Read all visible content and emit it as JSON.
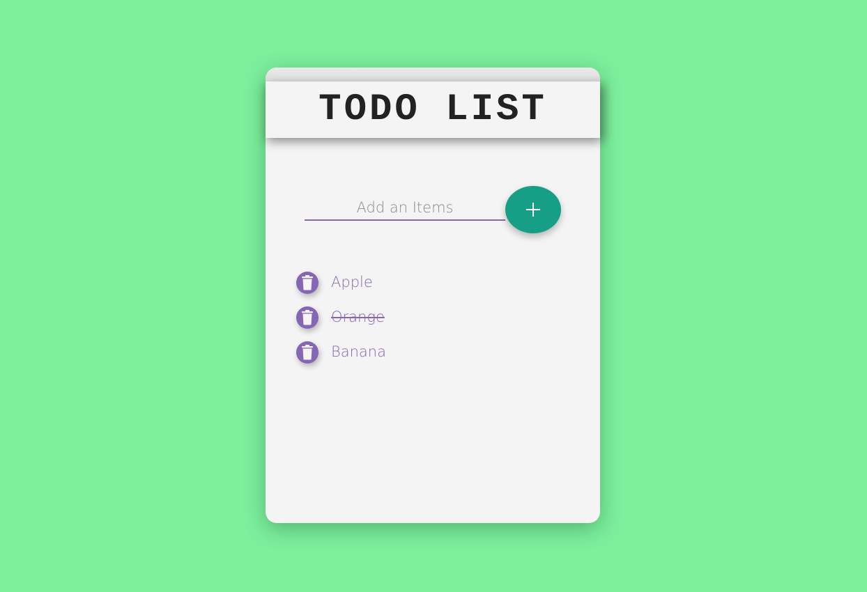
{
  "app": {
    "title": "TODO LIST"
  },
  "input": {
    "placeholder": "Add an Items",
    "value": ""
  },
  "add_button": {
    "icon": "plus-icon"
  },
  "items": [
    {
      "label": "Apple",
      "done": false,
      "icon": "trash-icon"
    },
    {
      "label": "Orange",
      "done": true,
      "icon": "trash-icon"
    },
    {
      "label": "Banana",
      "done": false,
      "icon": "trash-icon"
    }
  ],
  "colors": {
    "background": "#7def9d",
    "card": "#f4f4f4",
    "accent": "#8765b5",
    "add_button": "#169e87"
  }
}
